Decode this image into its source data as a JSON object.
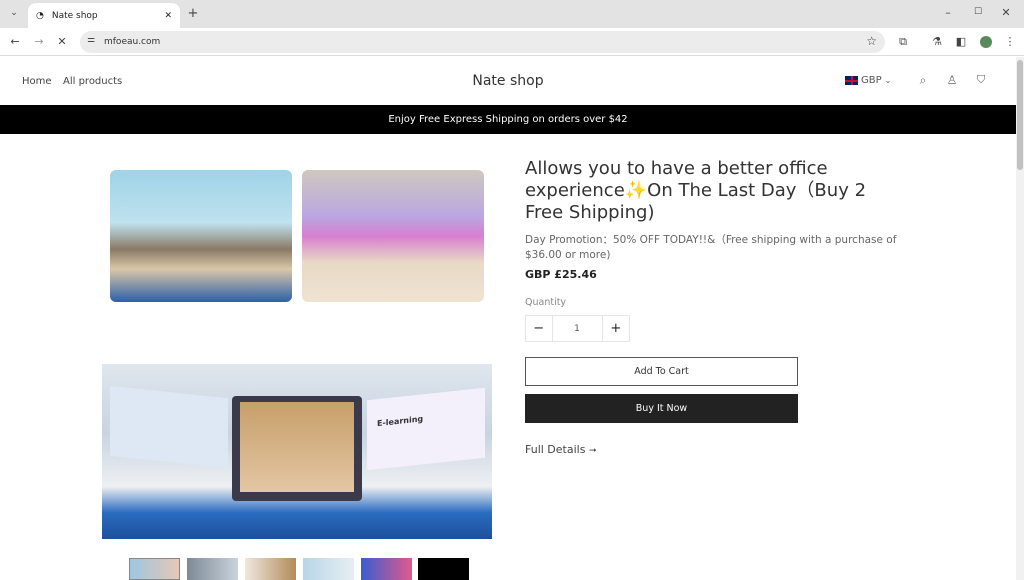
{
  "browser": {
    "tab_title": "Nate shop",
    "url": "mfoeau.com"
  },
  "header": {
    "nav": [
      "Home",
      "All products"
    ],
    "logo": "Nate shop",
    "currency": "GBP"
  },
  "banner": "Enjoy Free Express Shipping on orders over $42",
  "product": {
    "title": "Allows you to have a better office experience✨On The Last Day（Buy 2 Free Shipping)",
    "promo": "Day Promotion：50% OFF TODAY!!&（Free shipping with a purchase of $36.00 or more)",
    "price": "GBP £25.46",
    "quantity_label": "Quantity",
    "quantity": "1",
    "add_to_cart": "Add To Cart",
    "buy_now": "Buy It Now",
    "full_details": "Full Details",
    "big_image_text": "E-learning"
  },
  "thumbnail_count": 6
}
